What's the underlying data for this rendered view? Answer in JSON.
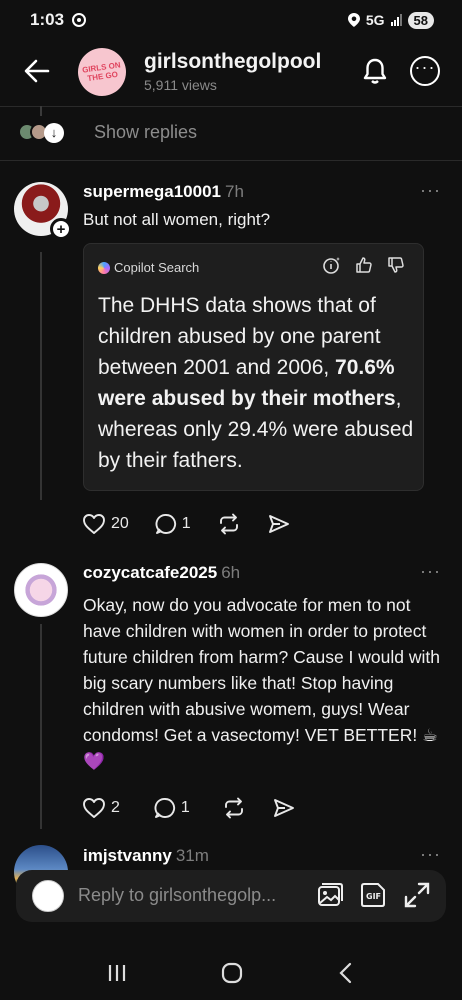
{
  "status": {
    "time": "1:03",
    "network": "5G",
    "battery": "58"
  },
  "header": {
    "title": "girlsonthegolpool",
    "views": "5,911 views",
    "avatar_text": "GIRLS ON THE GO"
  },
  "show_replies": {
    "label": "Show replies"
  },
  "comments": [
    {
      "username": "supermega10001",
      "time": "7h",
      "text": "But not all women, right?",
      "copilot": {
        "title": "Copilot Search",
        "text_1": "The DHHS data shows that of children abused by one parent between 2001 and 2006, ",
        "text_bold": "70.6% were abused by their mothers",
        "text_2": ", whereas only 29.4% were abused by their fathers."
      },
      "likes": "20",
      "replies": "1"
    },
    {
      "username": "cozycatcafe2025",
      "time": "6h",
      "text": "Okay, now do you advocate for men to not have children with women in order to protect future children from harm? Cause I would with big scary numbers like that! Stop having children with abusive womem, guys! Wear condoms! Get a vasectomy! VET BETTER! ☕💜",
      "likes": "2",
      "replies": "1"
    },
    {
      "username": "imjstvanny",
      "time": "31m"
    }
  ],
  "reply_bar": {
    "placeholder": "Reply to girlsonthegolp..."
  },
  "colors": {
    "background": "#101010",
    "card": "#1e1e1e",
    "muted": "#8a8a8a"
  }
}
